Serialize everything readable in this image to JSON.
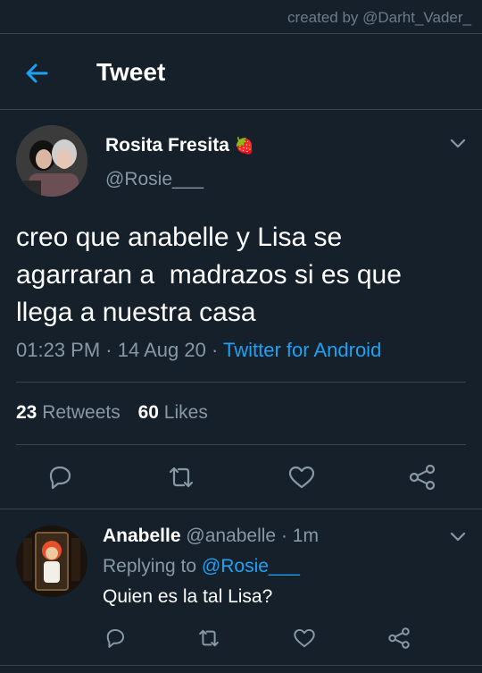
{
  "watermark": "created by @Darht_Vader_",
  "header": {
    "title": "Tweet"
  },
  "tweet": {
    "author_name": "Rosita Fresita",
    "author_emoji": "🍓",
    "author_handle": "@Rosie___",
    "text": "creo que anabelle y Lisa se\nagarraran a  madrazos si es que\nllega a nuestra casa",
    "time": "01:23 PM",
    "date": "14 Aug 20",
    "separator": " · ",
    "source": "Twitter for Android",
    "retweets_count": "23",
    "retweets_label": "Retweets",
    "likes_count": "60",
    "likes_label": "Likes",
    "actions": [
      "reply-icon",
      "retweet-icon",
      "like-icon",
      "share-icon"
    ]
  },
  "reply": {
    "author_name": "Anabelle",
    "author_handle": "@anabelle",
    "time_sep": " · ",
    "time": "1m",
    "replying_label": "Replying to ",
    "replying_to": "@Rosie___",
    "text": "Quien es la tal Lisa?",
    "actions": [
      "reply-icon",
      "retweet-icon",
      "like-icon",
      "share-icon"
    ]
  },
  "colors": {
    "background": "#15202b",
    "accent": "#1da1f2",
    "secondary_text": "#8899a6",
    "divider": "#38444d"
  }
}
